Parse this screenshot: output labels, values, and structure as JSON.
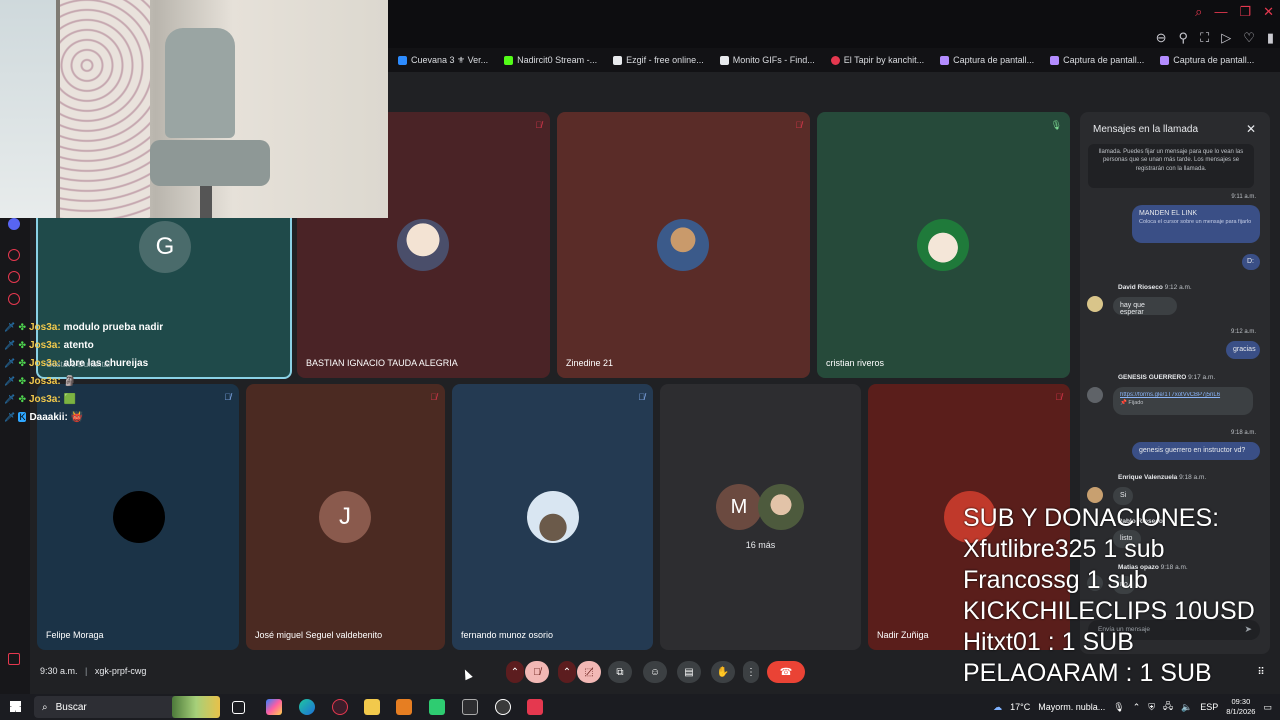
{
  "bookmarks": [
    {
      "label": "Cuevana 3 ⚜ Ver...",
      "color": "#2d8cff"
    },
    {
      "label": "Nadircit0 Stream -...",
      "color": "#53fc18"
    },
    {
      "label": "Ezgif - free online...",
      "color": "#e8eaed"
    },
    {
      "label": "Monito GIFs - Find...",
      "color": "#e8eaed"
    },
    {
      "label": "El Tapir by kanchit...",
      "color": "#e5384f"
    },
    {
      "label": "Captura de pantall...",
      "color": "#b38cff"
    },
    {
      "label": "Captura de pantall...",
      "color": "#b38cff"
    },
    {
      "label": "Captura de pantall...",
      "color": "#b38cff"
    }
  ],
  "tiles_top": [
    {
      "initial": "G",
      "name": "",
      "av_color": "#4a6b6b",
      "bg": "#1f4a4a"
    },
    {
      "name": "BASTIAN IGNACIO TAUDA ALEGRIA",
      "bg": "#4a2326"
    },
    {
      "name": "Zinedine 21",
      "bg": "#5a2c28"
    },
    {
      "name": "cristian riveros",
      "bg": "#264a3a"
    }
  ],
  "tiles_bottom": [
    {
      "name": "Felipe Moraga",
      "bg": "#1b3347"
    },
    {
      "initial": "J",
      "name": "José miguel Seguel valdebenito",
      "bg": "#4b2a22",
      "av_color": "#8a5a4d"
    },
    {
      "name": "fernando munoz osorio",
      "bg": "#243a52"
    },
    {
      "initial": "M",
      "more": "16 más",
      "bg": "#2d2d30",
      "av_color": "#6b4a40"
    },
    {
      "name": "Nadir Zuñiga",
      "bg": "#5a1e1b"
    }
  ],
  "stream_chat": [
    {
      "user": "Jos3a:",
      "msg": "modulo prueba nadir"
    },
    {
      "user": "Jos3a:",
      "msg": "atento"
    },
    {
      "user": "Jos3a:",
      "msg": "abre las chureijas"
    },
    {
      "user": "Jos3a:",
      "msg": "🗿"
    },
    {
      "user": "Jos3a:",
      "msg": "🟩"
    },
    {
      "user": "Daaakii:",
      "msg": "👹"
    }
  ],
  "chat_overlap_text": "Gustavo Durlantal",
  "panel": {
    "title": "Mensajes en la llamada",
    "notice": "llamada. Puedes fijar un mensaje para que lo vean las personas que se unan más tarde. Los mensajes se registrarán con la llamada.",
    "m1_time": "9:11 a.m.",
    "m1_text": "MANDEN EL LINK",
    "m1_hint": "Coloca el cursor sobre un mensaje para fijarlo",
    "m2_text": "D:",
    "david": "David Rioseco",
    "david_time": "9:12 a.m.",
    "david_msg": "hay que esperar",
    "m3_time": "9:12 a.m.",
    "m3_text": "gracias",
    "genesis": "GENESIS GUERRERO",
    "genesis_time": "9:17 a.m.",
    "genesis_link": "https://forms.gle/1T7xotVvCBP7j5nL6",
    "genesis_pinned": "Fijado",
    "m4_time": "9:18 a.m.",
    "m4_text": "genesis guerrero en instructor vd?",
    "enrique": "Enrique Valenzuela",
    "enrique_time": "9:18 a.m.",
    "enrique_msg": "Si",
    "p5": "Pablo Rioseco",
    "p5_msg": "listo",
    "matias": "Matias opazo",
    "matias_time": "9:18 a.m.",
    "matias_msg": "no",
    "input_placeholder": "Envía un mensaje"
  },
  "subs_lines": [
    "SUB Y DONACIONES:",
    "Xfutlibre325 1 sub",
    "Francossg 1 sub",
    "KICKCHILECLIPS 10USD",
    "Hitxt01 : 1 SUB",
    "PELAOARAM : 1 SUB"
  ],
  "meeting": {
    "time": "9:30 a.m.",
    "separator": "|",
    "code": "xgk-prpf-cwg"
  },
  "taskbar": {
    "search": "Buscar",
    "weather": "17°C",
    "weather_desc": "Mayorm. nubla...",
    "lang": "ESP",
    "time": "09:30",
    "date": "8/1/2026"
  }
}
